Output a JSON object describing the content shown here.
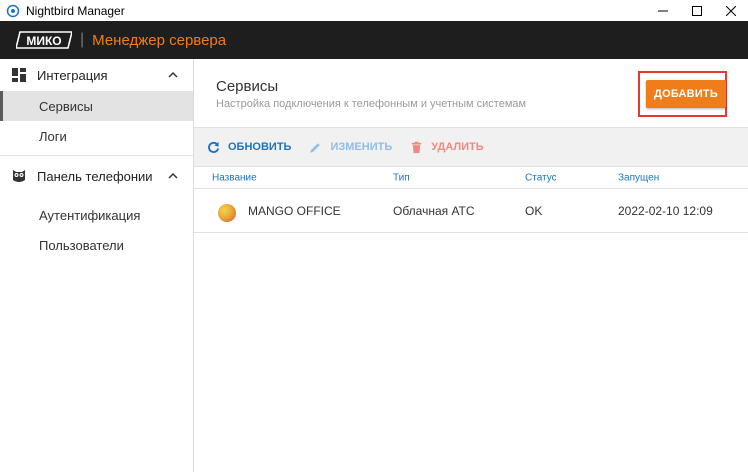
{
  "window": {
    "title": "Nightbird Manager"
  },
  "app": {
    "logo_text": "МИКО",
    "separator": "|",
    "title": "Менеджер сервера"
  },
  "sidebar": {
    "sections": [
      {
        "label": "Интеграция",
        "icon": "dashboard-icon",
        "items": [
          "Сервисы",
          "Логи"
        ]
      },
      {
        "label": "Панель телефонии",
        "icon": "owl-icon",
        "items": [
          "Аутентификация",
          "Пользователи"
        ]
      }
    ],
    "active_item": "Сервисы"
  },
  "main": {
    "title": "Сервисы",
    "subtitle": "Настройка подключения к телефонным и учетным системам",
    "add_button": "ДОБАВИТЬ",
    "toolbar": {
      "refresh": "ОБНОВИТЬ",
      "edit": "ИЗМЕНИТЬ",
      "delete": "УДАЛИТЬ"
    },
    "table": {
      "columns": [
        "Название",
        "Тип",
        "Статус",
        "Запущен"
      ],
      "rows": [
        {
          "name": "MANGO OFFICE",
          "type": "Облачная АТС",
          "status": "OK",
          "started": "2022-02-10 12:09"
        }
      ]
    }
  },
  "colors": {
    "accent": "#ef7d1a",
    "link": "#1e73be",
    "highlight": "#e53935"
  }
}
